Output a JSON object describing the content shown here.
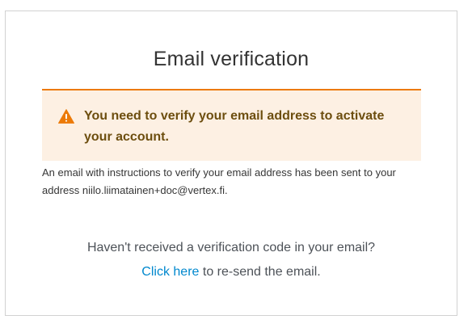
{
  "page": {
    "title": "Email verification"
  },
  "alert": {
    "icon": "warning-triangle-icon",
    "message": "You need to verify your email address to activate your account.",
    "accent_color": "#ec7a08",
    "background_color": "#fdf0e3",
    "text_color": "#6d4e0f"
  },
  "info": {
    "text": "An email with instructions to verify your email address has been sent to your address niilo.liimatainen+doc@vertex.fi."
  },
  "resend": {
    "question": "Haven't received a verification code in your email?",
    "link_label": "Click here",
    "suffix": " to re-send the email.",
    "link_color": "#0088ce"
  }
}
